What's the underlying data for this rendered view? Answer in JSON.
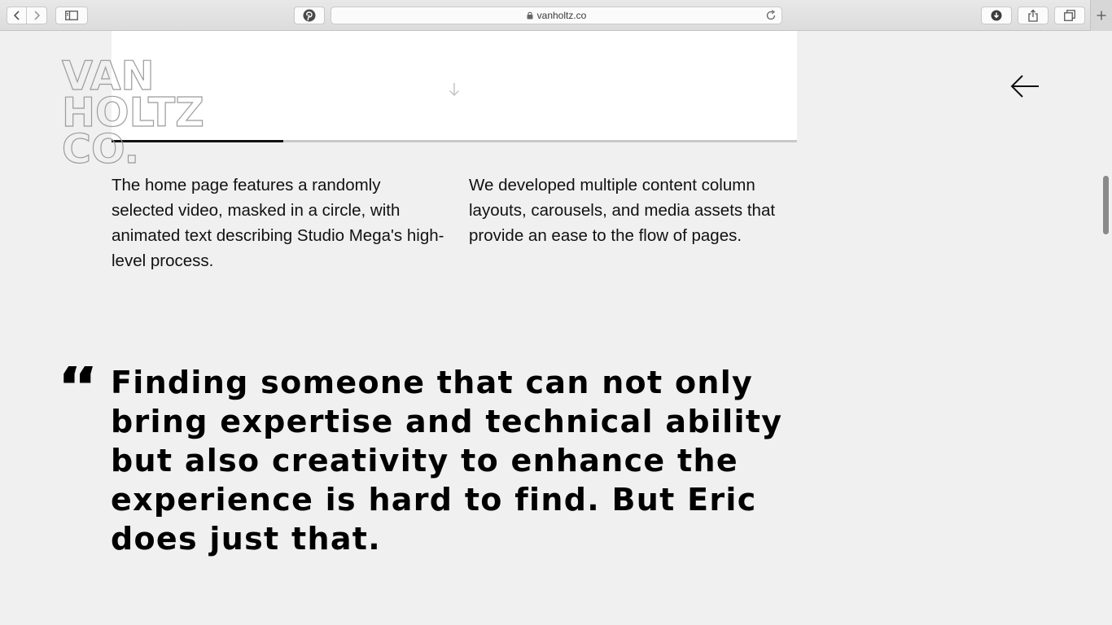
{
  "browser": {
    "url": "vanholtz.co",
    "icons": {
      "back": "chevron-left-icon",
      "forward": "chevron-right-icon",
      "sidebar": "sidebar-icon",
      "pinterest": "pinterest-icon",
      "lock": "lock-icon",
      "reload": "reload-icon",
      "downloads": "download-icon",
      "share": "share-icon",
      "tabs": "tabs-overview-icon",
      "new_tab": "plus-icon"
    }
  },
  "site": {
    "logo_lines": [
      "VAN",
      "HOLTZ",
      "CO."
    ],
    "nav_icon": "arrow-left-icon",
    "media_icon": "arrow-down-icon",
    "carousel_progress": 0.25
  },
  "content": {
    "left_paragraph": "The home page features a randomly selected video, masked in a circle, with animated text describing Studio Mega's high-level process.",
    "right_paragraph": "We developed multiple content column layouts, carousels, and media assets that provide an ease to the flow of pages.",
    "quote_mark": "“",
    "quote": "Finding someone that can not only bring expertise and technical ability but also creativity to enhance the experience is hard to find. But Eric does just that."
  },
  "colors": {
    "page_background": "#f0f0f0",
    "text": "#000000",
    "progress_fill": "#111111",
    "progress_track": "#c8c8c8"
  }
}
